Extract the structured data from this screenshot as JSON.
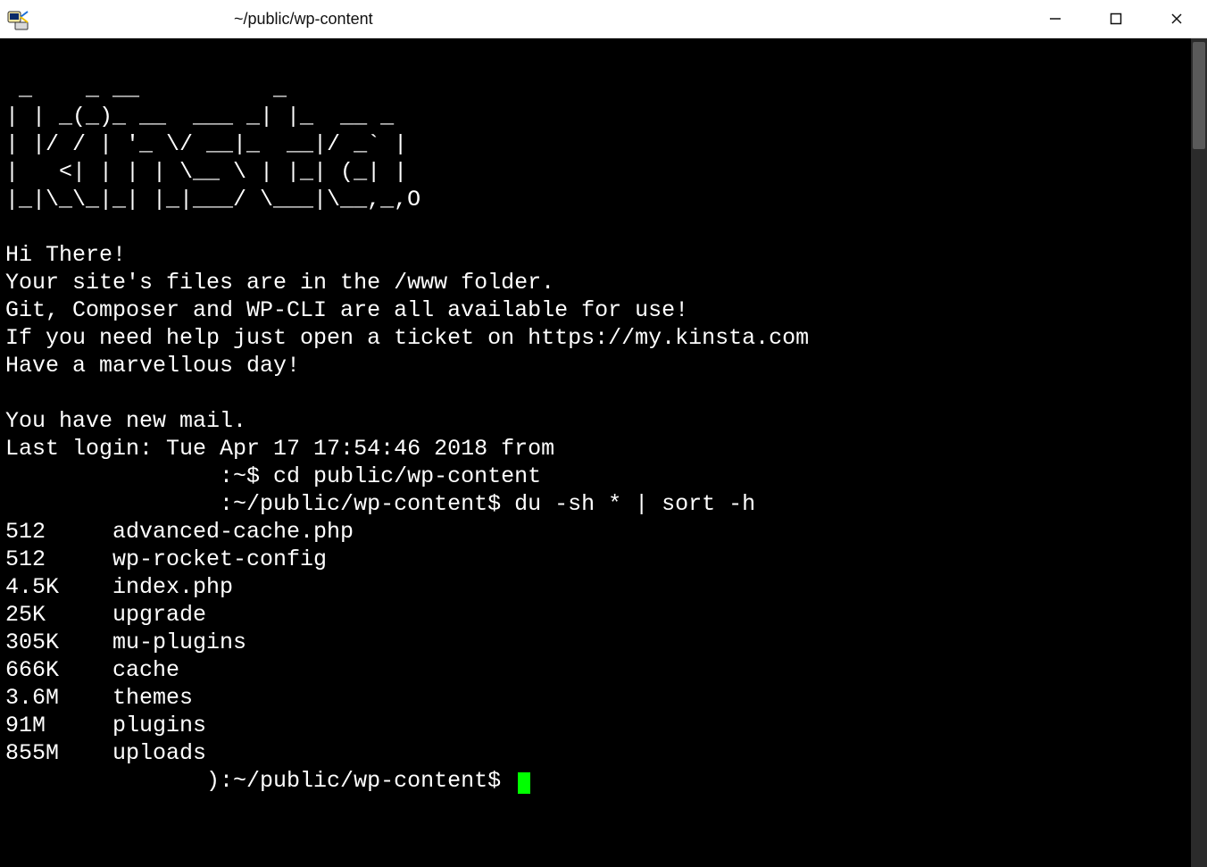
{
  "window": {
    "title": "~/public/wp-content"
  },
  "terminal": {
    "ascii_art": " _    _ __          _\n| | _(_)_ __  ___ _| |_  __ _\n| |/ / | '_ \\/ __|_  __|/ _` |\n|   <| | | | \\__ \\ | |_| (_| |\n|_|\\_\\_|_| |_|___/ \\___|\\__,_,O",
    "greeting": [
      "Hi There!",
      "Your site's files are in the /www folder.",
      "Git, Composer and WP-CLI are all available for use!",
      "If you need help just open a ticket on https://my.kinsta.com",
      "Have a marvellous day!"
    ],
    "mail_notice": "You have new mail.",
    "last_login": "Last login: Tue Apr 17 17:54:46 2018 from",
    "prompt1": "                :~$ cd public/wp-content",
    "prompt2": "                :~/public/wp-content$ du -sh * | sort -h",
    "du": [
      {
        "size": "512",
        "name": "advanced-cache.php"
      },
      {
        "size": "512",
        "name": "wp-rocket-config"
      },
      {
        "size": "4.5K",
        "name": "index.php"
      },
      {
        "size": "25K",
        "name": "upgrade"
      },
      {
        "size": "305K",
        "name": "mu-plugins"
      },
      {
        "size": "666K",
        "name": "cache"
      },
      {
        "size": "3.6M",
        "name": "themes"
      },
      {
        "size": "91M",
        "name": "plugins"
      },
      {
        "size": "855M",
        "name": "uploads"
      }
    ],
    "prompt3": "               ):~/public/wp-content$ "
  }
}
